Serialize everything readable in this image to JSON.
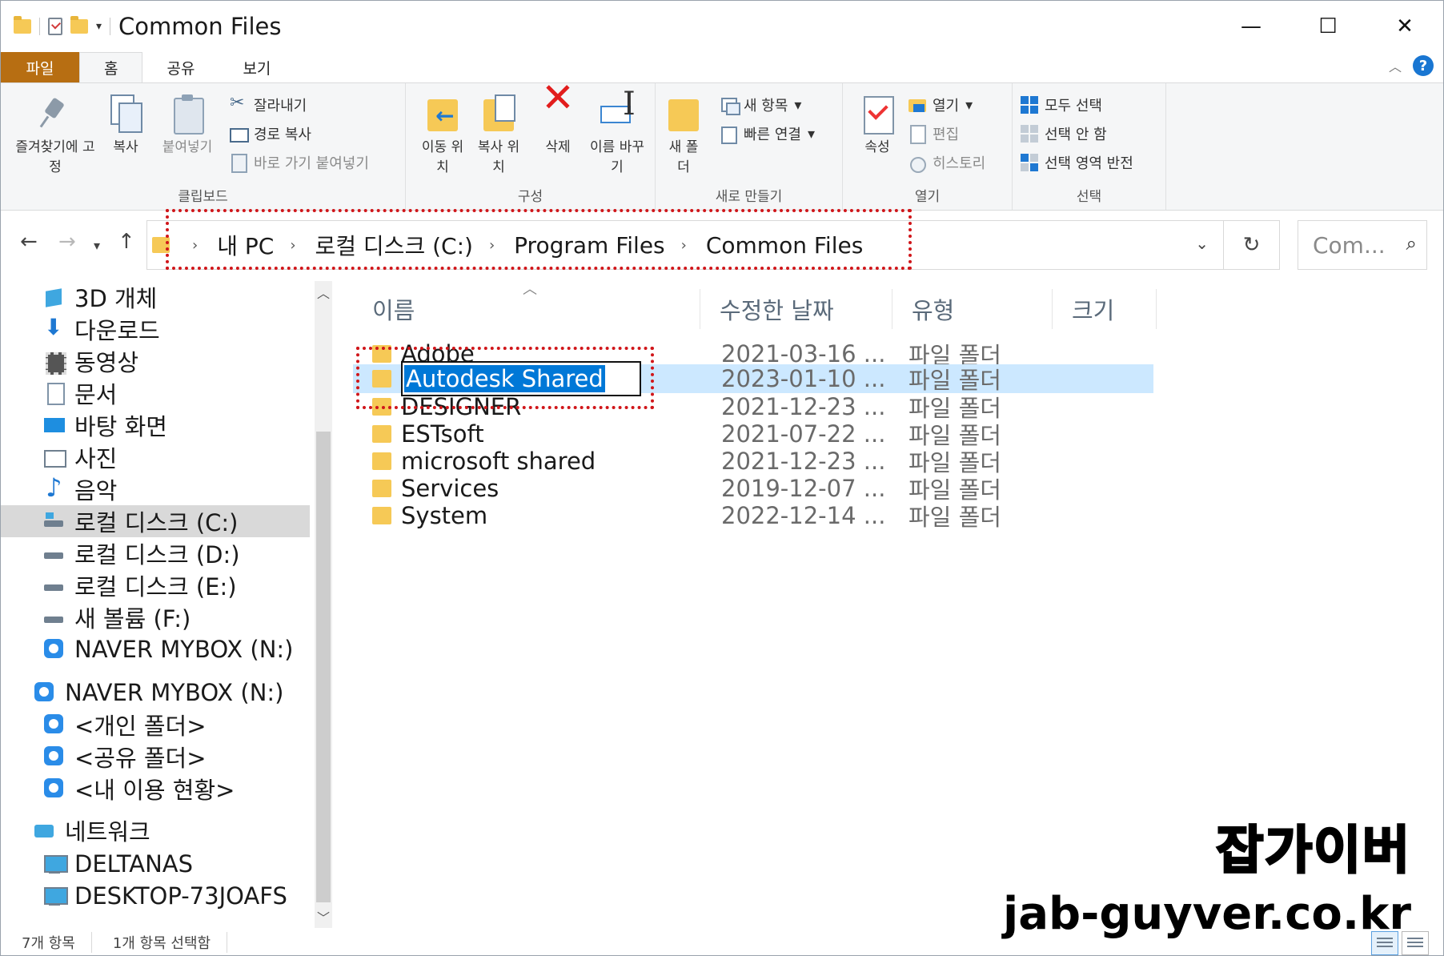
{
  "window": {
    "title": "Common Files",
    "controls": {
      "minimize": "—",
      "maximize": "☐",
      "close": "✕"
    }
  },
  "ribbon": {
    "tabs": [
      {
        "label": "파일"
      },
      {
        "label": "홈"
      },
      {
        "label": "공유"
      },
      {
        "label": "보기"
      }
    ],
    "clipboard": {
      "label": "클립보드",
      "pin": "즐겨찾기에 고정",
      "copy": "복사",
      "paste": "붙여넣기",
      "cut": "잘라내기",
      "copy_path": "경로 복사",
      "paste_shortcut": "바로 가기 붙여넣기"
    },
    "organize": {
      "label": "구성",
      "move_to": "이동 위치",
      "copy_to": "복사 위치",
      "delete": "삭제",
      "rename": "이름 바꾸기"
    },
    "new": {
      "label": "새로 만들기",
      "new_folder": "새 폴더",
      "new_item": "새 항목",
      "easy_access": "빠른 연결"
    },
    "open": {
      "label": "열기",
      "properties": "속성",
      "open": "열기",
      "edit": "편집",
      "history": "히스토리"
    },
    "select": {
      "label": "선택",
      "select_all": "모두 선택",
      "select_none": "선택 안 함",
      "invert": "선택 영역 반전"
    }
  },
  "address": {
    "breadcrumbs": [
      "내 PC",
      "로컬 디스크 (C:)",
      "Program Files",
      "Common Files"
    ],
    "search_placeholder": "Com..."
  },
  "nav_pane": {
    "items": [
      {
        "label": "3D 개체",
        "icon": "3d-objects-icon"
      },
      {
        "label": "다운로드",
        "icon": "downloads-icon"
      },
      {
        "label": "동영상",
        "icon": "videos-icon"
      },
      {
        "label": "문서",
        "icon": "documents-icon"
      },
      {
        "label": "바탕 화면",
        "icon": "desktop-icon"
      },
      {
        "label": "사진",
        "icon": "pictures-icon"
      },
      {
        "label": "음악",
        "icon": "music-icon"
      },
      {
        "label": "로컬 디스크 (C:)",
        "icon": "drive-icon",
        "selected": true
      },
      {
        "label": "로컬 디스크 (D:)",
        "icon": "drive-icon"
      },
      {
        "label": "로컬 디스크 (E:)",
        "icon": "drive-icon"
      },
      {
        "label": "새 볼륨 (F:)",
        "icon": "drive-icon"
      },
      {
        "label": "NAVER MYBOX (N:)",
        "icon": "mybox-icon"
      },
      {
        "label": "NAVER MYBOX (N:)",
        "icon": "mybox-icon"
      },
      {
        "label": "<개인 폴더>",
        "icon": "mybox-folder-icon"
      },
      {
        "label": "<공유 폴더>",
        "icon": "mybox-folder-icon"
      },
      {
        "label": "<내 이용 현황>",
        "icon": "mybox-usage-icon"
      },
      {
        "label": "네트워크",
        "icon": "network-icon"
      },
      {
        "label": "DELTANAS",
        "icon": "computer-icon"
      },
      {
        "label": "DESKTOP-73JOAFS",
        "icon": "computer-icon"
      }
    ]
  },
  "file_list": {
    "columns": [
      "이름",
      "수정한 날짜",
      "유형",
      "크기"
    ],
    "rows": [
      {
        "name": "Adobe",
        "date": "2021-03-16 ...",
        "type": "파일 폴더"
      },
      {
        "name": "Autodesk Shared",
        "date": "2023-01-10 ...",
        "type": "파일 폴더",
        "selected": true,
        "renaming": true
      },
      {
        "name": "DESIGNER",
        "date": "2021-12-23 ...",
        "type": "파일 폴더"
      },
      {
        "name": "ESTsoft",
        "date": "2021-07-22 ...",
        "type": "파일 폴더"
      },
      {
        "name": "microsoft shared",
        "date": "2021-12-23 ...",
        "type": "파일 폴더"
      },
      {
        "name": "Services",
        "date": "2019-12-07 ...",
        "type": "파일 폴더"
      },
      {
        "name": "System",
        "date": "2022-12-14 ...",
        "type": "파일 폴더"
      }
    ]
  },
  "status": {
    "item_count": "7개 항목",
    "selected_count": "1개 항목 선택함"
  },
  "watermark": {
    "line1": "잡가이버",
    "line2": "jab-guyver.co.kr"
  },
  "colors": {
    "file_tab": "#b76e12",
    "selection": "#cce8ff",
    "annotation": "#d0161a",
    "folder": "#f6c956"
  }
}
